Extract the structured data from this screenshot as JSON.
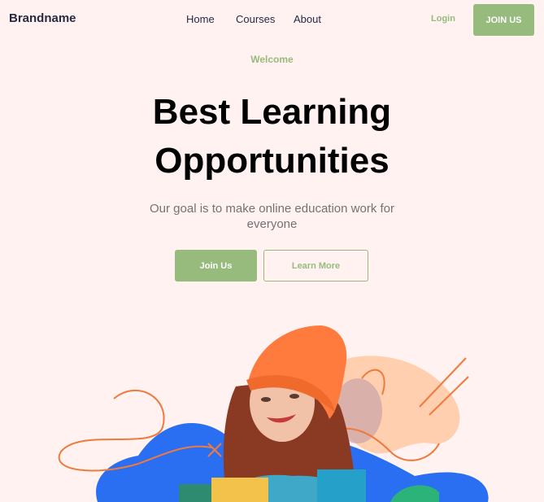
{
  "header": {
    "brand": "Brandname",
    "nav": [
      "Home",
      "Courses",
      "About"
    ],
    "login_label": "Login",
    "join_label": "JOIN US"
  },
  "hero": {
    "eyebrow": "Welcome",
    "title_line1": "Best Learning",
    "title_line2": "Opportunities",
    "subtitle": "Our goal is to make online education work for everyone",
    "primary_button": "Join Us",
    "secondary_button": "Learn More"
  },
  "colors": {
    "background": "#fff2f1",
    "accent": "#96bb7c",
    "heading": "#000000",
    "text_muted": "#737373",
    "blob_blue": "#2a6ff2",
    "blob_peach": "#ffcfb0",
    "beanie": "#ff7a3d"
  }
}
